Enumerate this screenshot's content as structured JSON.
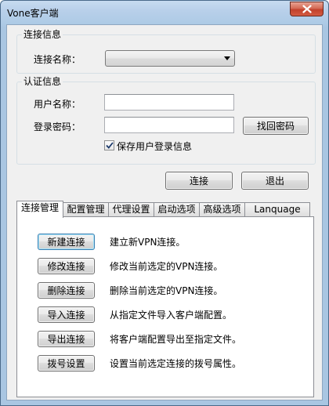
{
  "window": {
    "title": "Vone客户端"
  },
  "connection_group": {
    "legend": "连接信息",
    "name_label": "连接名称：",
    "name_value": ""
  },
  "auth_group": {
    "legend": "认证信息",
    "username_label": "用户名称：",
    "username_value": "",
    "password_label": "登录密码：",
    "password_value": "",
    "recover_button": "找回密码",
    "save_checkbox_label": "保存用户登录信息",
    "save_checked": true
  },
  "actions": {
    "connect": "连接",
    "exit": "退出"
  },
  "tabs": [
    {
      "label": "连接管理",
      "active": true
    },
    {
      "label": "配置管理",
      "active": false
    },
    {
      "label": "代理设置",
      "active": false
    },
    {
      "label": "启动选项",
      "active": false
    },
    {
      "label": "高级选项",
      "active": false
    },
    {
      "label": "Lanquage",
      "active": false
    }
  ],
  "manage_rows": [
    {
      "button": "新建连接",
      "description": "建立新VPN连接。"
    },
    {
      "button": "修改连接",
      "description": "修改当前选定的VPN连接。"
    },
    {
      "button": "删除连接",
      "description": "删除当前选定的VPN连接。"
    },
    {
      "button": "导入连接",
      "description": "从指定文件导入客户端配置。"
    },
    {
      "button": "导出连接",
      "description": "将客户端配置导出至指定文件。"
    },
    {
      "button": "拨号设置",
      "description": "设置当前选定连接的拨号属性。"
    }
  ],
  "icons": {
    "close": "close-icon",
    "dropdown": "chevron-down-icon",
    "check": "checkmark-icon"
  }
}
